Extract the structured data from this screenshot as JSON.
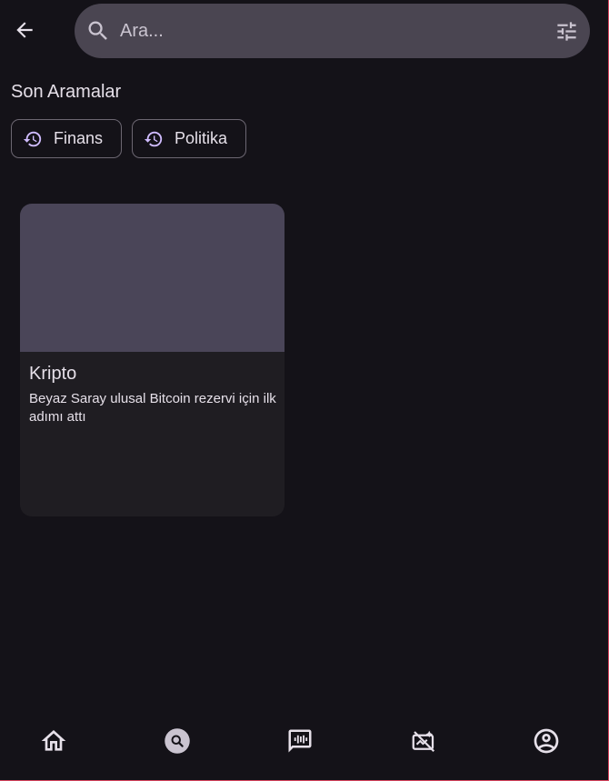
{
  "header": {
    "search_placeholder": "Ara..."
  },
  "recent_searches": {
    "title": "Son Aramalar",
    "chips": [
      {
        "label": "Finans"
      },
      {
        "label": "Politika"
      }
    ]
  },
  "results": [
    {
      "category": "Kripto",
      "description": "Beyaz Saray ulusal Bitcoin rezervi için ilk adımı attı"
    }
  ],
  "bottom_nav": [
    {
      "icon": "home-icon",
      "active": false
    },
    {
      "icon": "search-icon",
      "active": true
    },
    {
      "icon": "audio-chat-icon",
      "active": false
    },
    {
      "icon": "ai-icon",
      "active": false
    },
    {
      "icon": "profile-icon",
      "active": false
    }
  ],
  "colors": {
    "background": "#141218",
    "surface": "#4a4551",
    "card": "#1f1d22",
    "accent": "#D0BCFF"
  }
}
